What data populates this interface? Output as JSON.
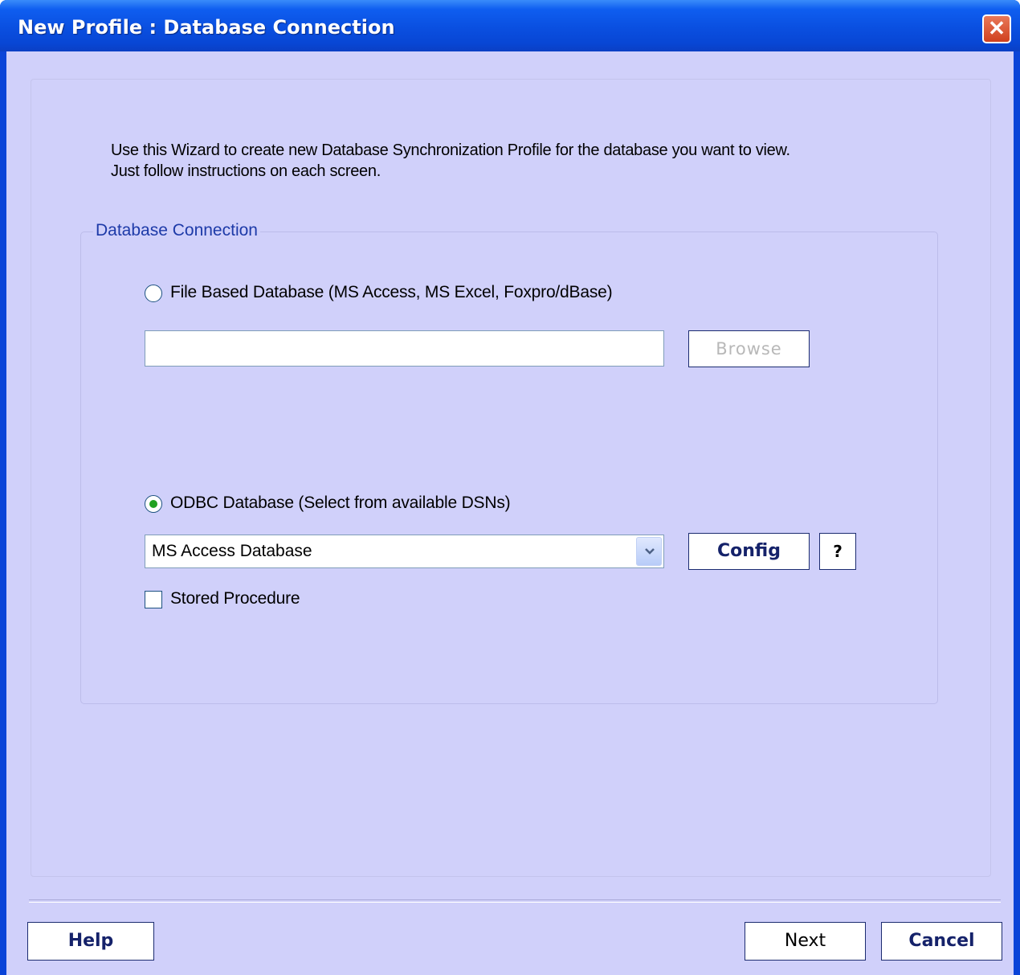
{
  "window": {
    "title": "New Profile : Database Connection",
    "close_symbol": "✕"
  },
  "intro": {
    "line1": "Use this Wizard to create new Database Synchronization Profile for the database you want to view.",
    "line2": "Just follow instructions on each screen."
  },
  "group": {
    "legend": "Database Connection",
    "file_option": {
      "label": "File Based Database (MS Access, MS Excel, Foxpro/dBase)",
      "selected": false
    },
    "file_path": "",
    "browse_label": "Browse",
    "odbc_option": {
      "label": "ODBC Database (Select from available DSNs)",
      "selected": true
    },
    "dsn_selected": "MS Access Database",
    "config_label": "Config",
    "help_q_label": "?",
    "stored_procedure": {
      "label": "Stored Procedure",
      "checked": false
    }
  },
  "footer": {
    "help_label": "Help",
    "next_label": "Next",
    "cancel_label": "Cancel"
  },
  "colors": {
    "title_bar": "#0a4fe0",
    "client_bg": "#d0d0fa",
    "legend_text": "#1d3aa8",
    "radio_dot": "#21a121",
    "close_button": "#d0401e"
  }
}
